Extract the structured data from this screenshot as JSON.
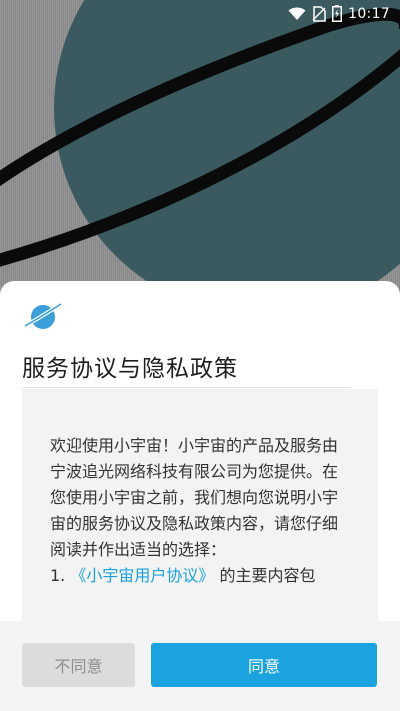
{
  "status_bar": {
    "time": "10:17",
    "icons": [
      "wifi-icon",
      "no-sim-icon",
      "battery-icon"
    ]
  },
  "background": {
    "planet_color": "#3a5a5f",
    "ring_color": "#0a0a0a",
    "backdrop_color": "#8f8f8f"
  },
  "dialog": {
    "logo": "planet-logo-icon",
    "title": "服务协议与隐私政策",
    "intro": "欢迎使用小宇宙！小宇宙的产品及服务由宁波追光网络科技有限公司为您提供。在您使用小宇宙之前，我们想向您说明小宇宙的服务协议及隐私政策内容，请您仔细阅读并作出适当的选择：",
    "item_number": "1.",
    "item_link": "《小宇宙用户协议》",
    "item_text": "的主要内容包"
  },
  "buttons": {
    "disagree": "不同意",
    "agree": "同意"
  },
  "colors": {
    "accent": "#1aa3de",
    "disagree_bg": "#dcdcdc"
  }
}
